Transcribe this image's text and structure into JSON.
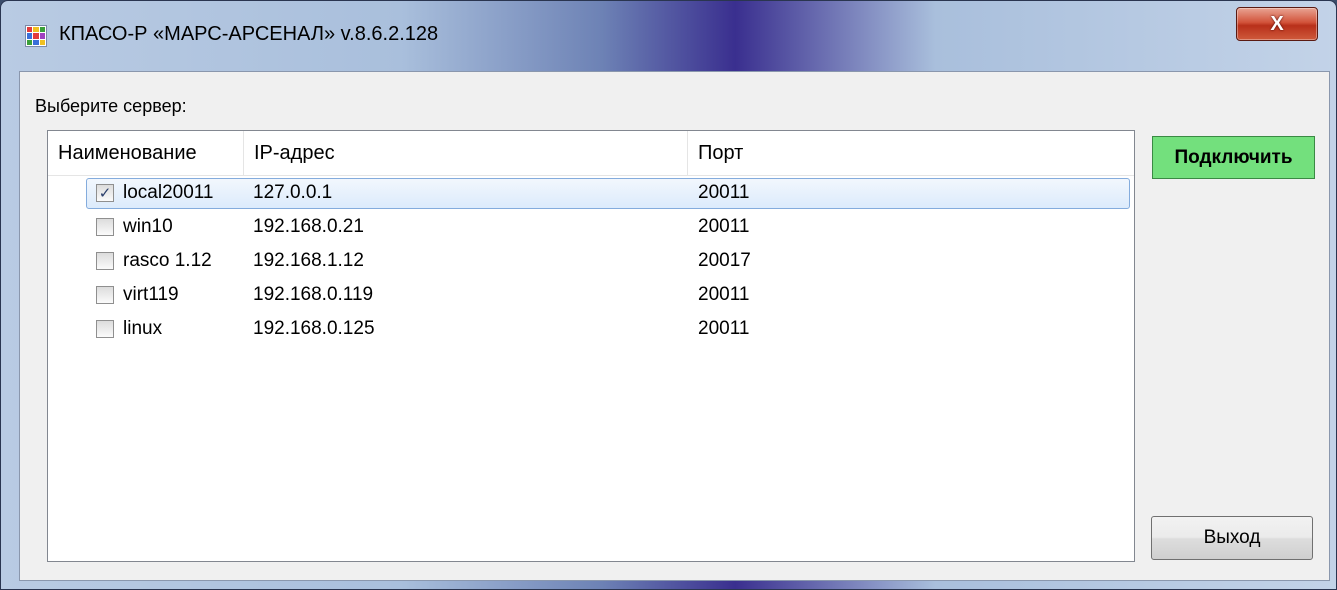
{
  "window": {
    "title": "КПАСО-Р «МАРС-АРСЕНАЛ» v.8.6.2.128",
    "close_label": "X"
  },
  "prompt": "Выберите сервер:",
  "table": {
    "columns": [
      "Наименование",
      "IP-адрес",
      "Порт"
    ],
    "rows": [
      {
        "name": "local20011",
        "ip": "127.0.0.1",
        "port": "20011",
        "checked": true
      },
      {
        "name": "win10",
        "ip": "192.168.0.21",
        "port": "20011",
        "checked": false
      },
      {
        "name": "rasco 1.12",
        "ip": "192.168.1.12",
        "port": "20017",
        "checked": false
      },
      {
        "name": "virt119",
        "ip": "192.168.0.119",
        "port": "20011",
        "checked": false
      },
      {
        "name": "linux",
        "ip": "192.168.0.125",
        "port": "20011",
        "checked": false
      }
    ]
  },
  "buttons": {
    "connect": "Подключить",
    "exit": "Выход"
  },
  "colors": {
    "connect_bg": "#73e07d",
    "selection_border": "#84acdd"
  }
}
